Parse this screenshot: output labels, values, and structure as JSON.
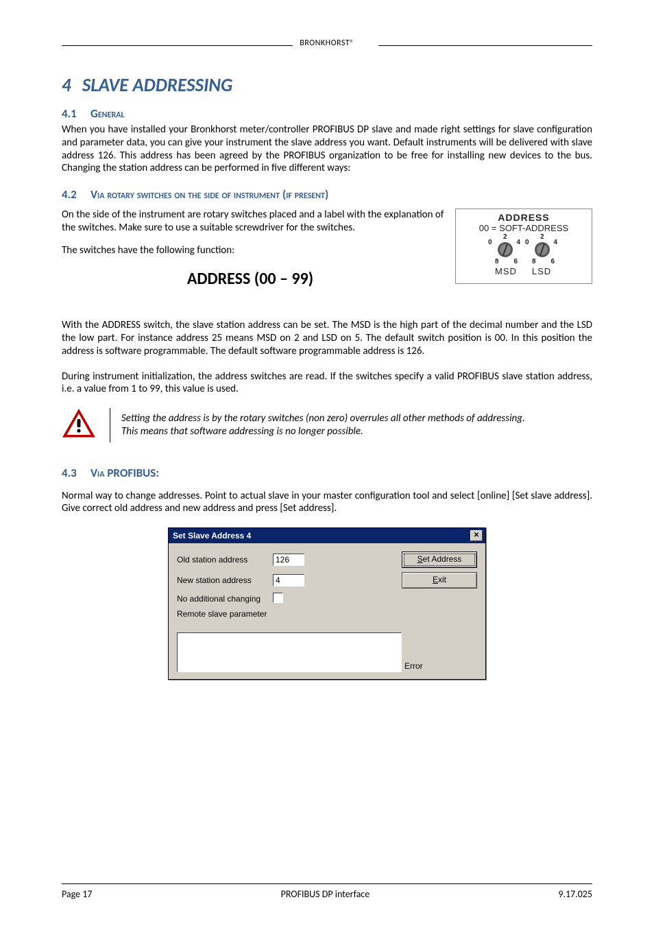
{
  "header": {
    "brand": "BRONKHORST®"
  },
  "section4": {
    "number": "4",
    "title": "SLAVE ADDRESSING"
  },
  "section41": {
    "number": "4.1",
    "title": "General",
    "body": "When you have installed your Bronkhorst meter/controller PROFIBUS DP slave and made right settings for slave configuration and parameter data, you can give your instrument the slave address you want. Default instruments will be delivered with slave address 126. This address has been agreed by the PROFIBUS organization to be free for installing new devices to the bus. Changing the station address can be performed in five different ways:"
  },
  "section42": {
    "number": "4.2",
    "title": "Via rotary switches on the side of instrument (if present)",
    "p1": "On the side of the instrument are rotary switches placed and a label with the explanation of the switches. Make sure to use a suitable screwdriver for the switches.",
    "p2": "The switches have the following function:",
    "addr_heading": "ADDRESS (00 – 99)",
    "label": {
      "line1": "ADDRESS",
      "line2": "00 = SOFT-ADDRESS",
      "msd": "MSD",
      "lsd": "LSD",
      "dial_numbers": [
        "0",
        "2",
        "4",
        "6",
        "8"
      ]
    },
    "p3": "With the ADDRESS switch, the slave station address can be set. The MSD is the high part of the decimal number and the LSD the low part. For instance address 25 means MSD on 2 and LSD on 5. The default switch position is 00. In this position the address is software programmable. The default software programmable address is 126.",
    "p4": "During instrument initialization, the address switches are read. If the switches specify a valid PROFIBUS slave station address, i.e. a value from 1 to 99, this value is used.",
    "warning_l1": "Setting the address is by the rotary switches (non zero) overrules all other methods of addressing.",
    "warning_l2": "This means that software addressing is no longer possible."
  },
  "section43": {
    "number": "4.3",
    "title": "Via PROFIBUS:",
    "p1": "Normal way to change addresses. Point to actual slave in your master configuration tool and select [online] [Set slave address]. Give correct old address and new address and press [Set address]."
  },
  "dialog": {
    "title": "Set Slave Address 4",
    "close_glyph": "✕",
    "old_label": "Old station address",
    "old_value": "126",
    "new_label": "New station address",
    "new_value": "4",
    "noadd_label": "No additional changing",
    "noadd_checked": false,
    "remote_label": "Remote slave parameter",
    "btn_set_prefix": "S",
    "btn_set_rest": "et Address",
    "btn_exit_prefix": "E",
    "btn_exit_rest": "xit",
    "error_label": "Error"
  },
  "footer": {
    "left": "Page 17",
    "center": "PROFIBUS DP interface",
    "right": "9.17.025"
  }
}
